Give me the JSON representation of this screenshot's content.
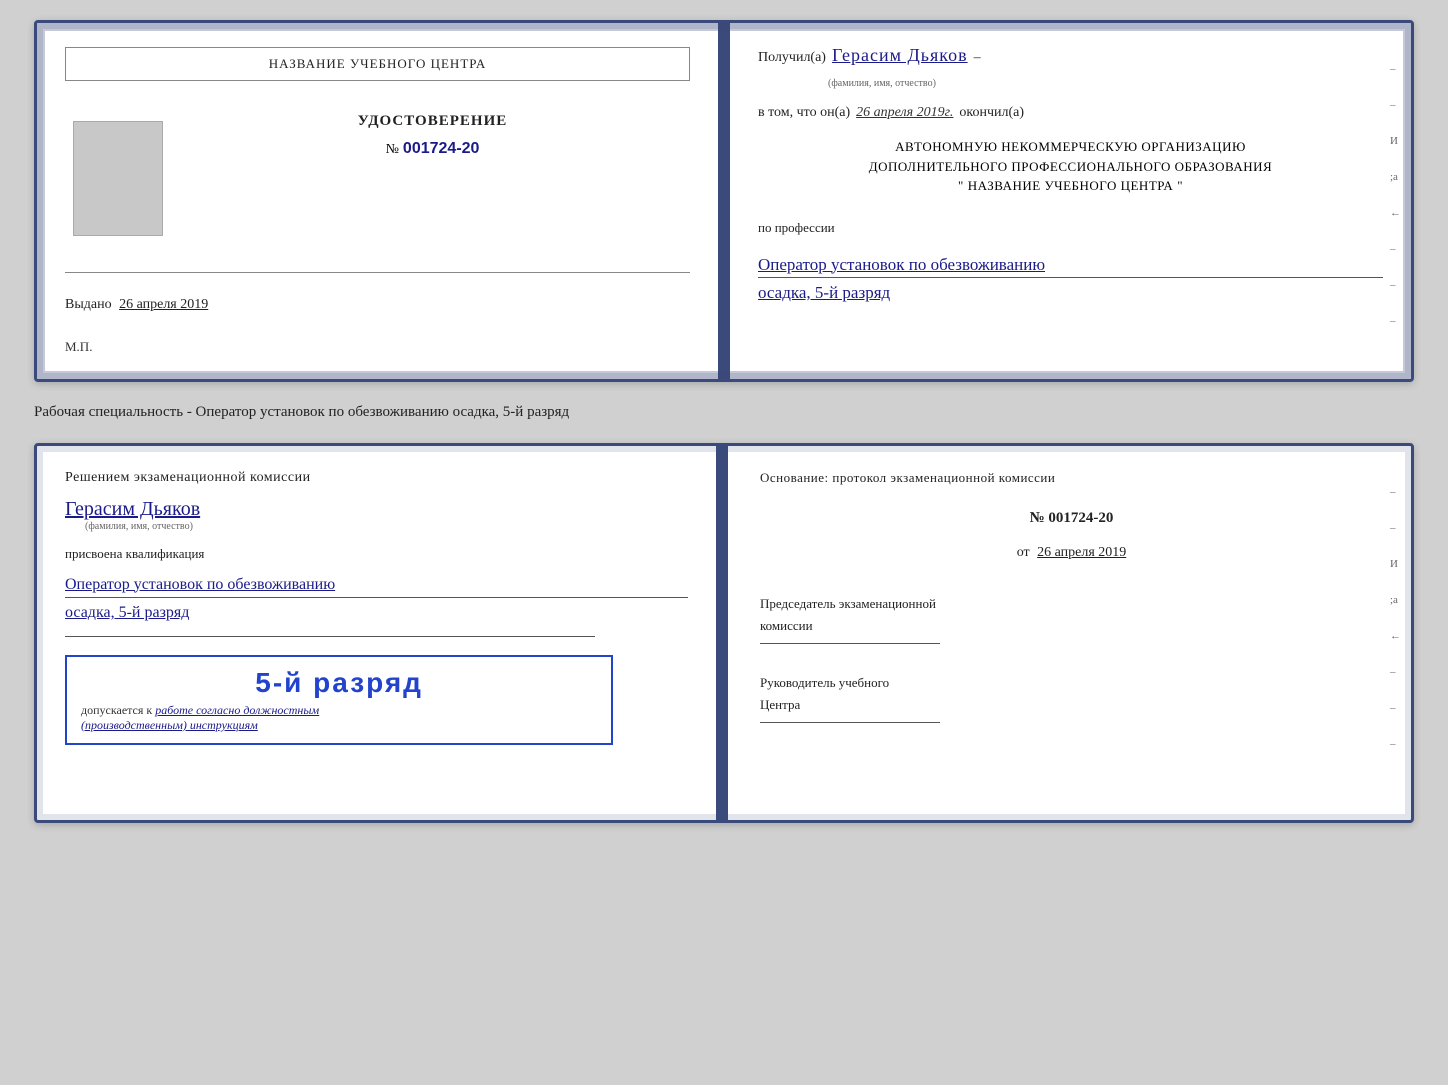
{
  "page": {
    "background": "#d0d0d0"
  },
  "card1": {
    "left": {
      "school_name": "НАЗВАНИЕ УЧЕБНОГО ЦЕНТРА",
      "cert_label": "УДОСТОВЕРЕНИЕ",
      "cert_number_prefix": "№",
      "cert_number": "001724-20",
      "issued_label": "Выдано",
      "issued_date": "26 апреля 2019",
      "mp_label": "М.П."
    },
    "right": {
      "received_label": "Получил(а)",
      "recipient_name": "Герасим Дьяков",
      "name_sublabel": "(фамилия, имя, отчество)",
      "dash": "–",
      "confirm_text": "в том, что он(а)",
      "confirm_date": "26 апреля 2019г.",
      "finished_label": "окончил(а)",
      "org_line1": "АВТОНОМНУЮ НЕКОММЕРЧЕСКУЮ ОРГАНИЗАЦИЮ",
      "org_line2": "ДОПОЛНИТЕЛЬНОГО ПРОФЕССИОНАЛЬНОГО ОБРАЗОВАНИЯ",
      "org_quotes": "\"",
      "school_name_right": "НАЗВАНИЕ УЧЕБНОГО ЦЕНТРА",
      "org_close_quote": "\"",
      "profession_label": "по профессии",
      "profession_name_line1": "Оператор установок по обезвоживанию",
      "profession_name_line2": "осадка, 5-й разряд"
    }
  },
  "specialty_info": "Рабочая специальность - Оператор установок по обезвоживанию осадка, 5-й разряд",
  "card2": {
    "left": {
      "decision_text": "Решением экзаменационной комиссии",
      "person_name": "Герасим Дьяков",
      "name_sublabel": "(фамилия, имя, отчество)",
      "assigned_text": "присвоена квалификация",
      "qualification_line1": "Оператор установок по обезвоживанию",
      "qualification_line2": "осадка, 5-й разряд",
      "stamp_rank": "5-й разряд",
      "stamp_allow_text": "допускается к",
      "stamp_allow_italic": "работе согласно должностным",
      "stamp_allow_italic2": "(производственным) инструкциям"
    },
    "right": {
      "basis_text": "Основание: протокол экзаменационной комиссии",
      "protocol_number": "№ 001724-20",
      "date_prefix": "от",
      "protocol_date": "26 апреля 2019",
      "chairman_label_line1": "Председатель экзаменационной",
      "chairman_label_line2": "комиссии",
      "head_label_line1": "Руководитель учебного",
      "head_label_line2": "Центра"
    }
  },
  "margin_marks": {
    "top": "–",
    "middle1": "–",
    "middle2": "–",
    "i": "И",
    "a": ";а",
    "arrow": "←",
    "bottom1": "–",
    "bottom2": "–",
    "bottom3": "–"
  }
}
